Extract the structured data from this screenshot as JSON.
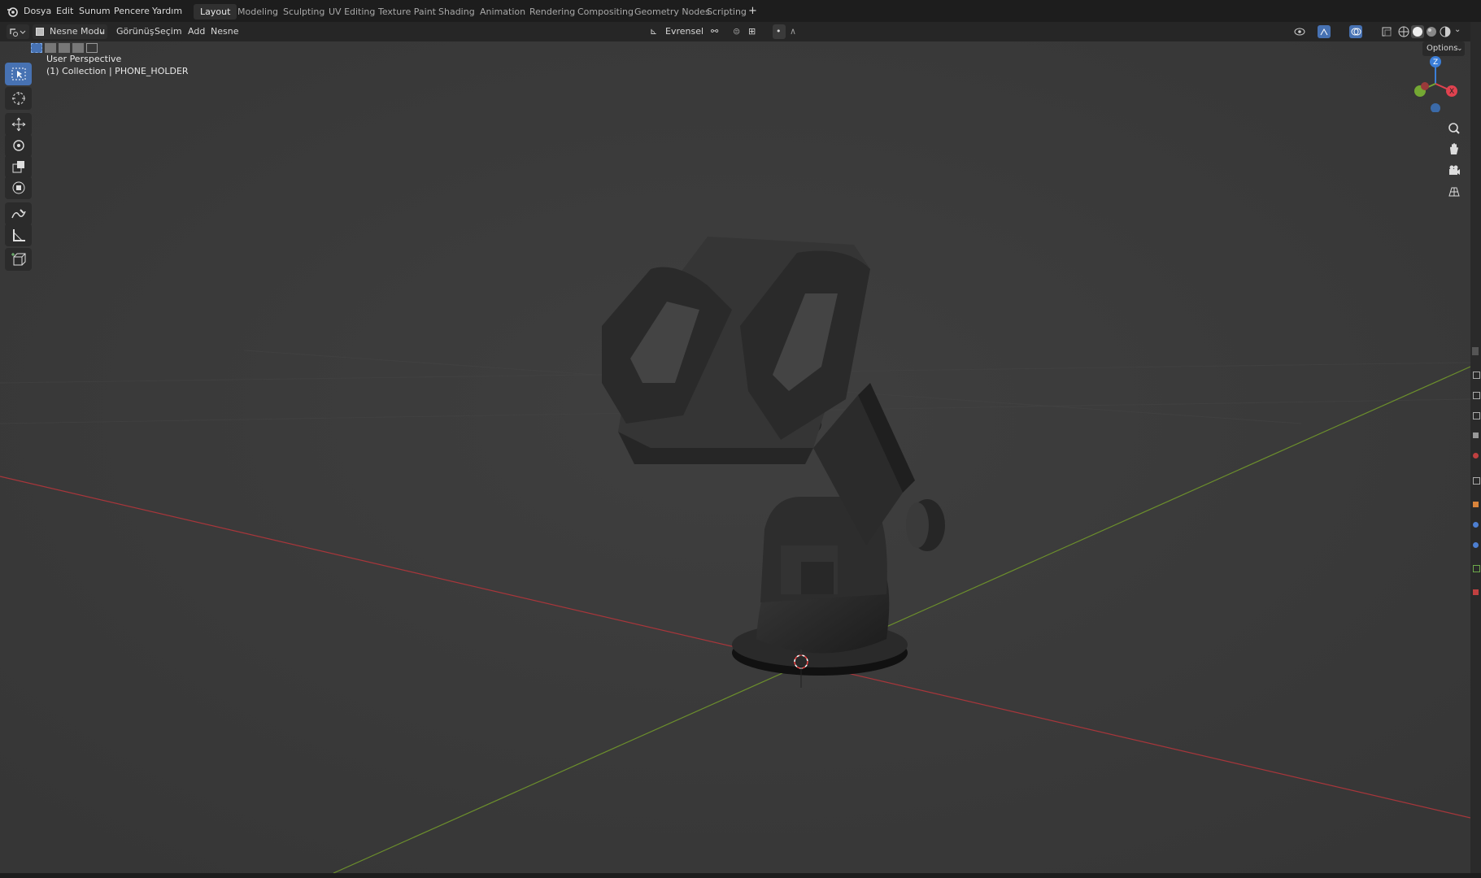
{
  "menu": {
    "app_icon": "blender-logo-icon",
    "items": [
      "Dosya",
      "Edit",
      "Sunum",
      "Pencere",
      "Yardım"
    ]
  },
  "workspaces": [
    "Layout",
    "Modeling",
    "Sculpting",
    "UV Editing",
    "Texture Paint",
    "Shading",
    "Animation",
    "Rendering",
    "Compositing",
    "Geometry Nodes",
    "Scripting"
  ],
  "workspaces_add": "+",
  "header": {
    "mode": "Nesne Modu",
    "menus": [
      "Görünüş",
      "Seçim",
      "Add",
      "Nesne"
    ],
    "orientation": "Evrensel",
    "options": "Options"
  },
  "viewport": {
    "perspective": "User Perspective",
    "collection": "(1) Collection | PHONE_HOLDER"
  },
  "gizmo": {
    "z": "Z",
    "x": "X",
    "x_color": "#e0424f",
    "y_color": "#74a833",
    "z_color": "#3b7ed8"
  },
  "tools": [
    "select-box-icon",
    "cursor-icon",
    "move-icon",
    "rotate-icon",
    "scale-icon",
    "transform-icon",
    "annotate-icon",
    "measure-icon",
    "add-cube-icon"
  ],
  "colors": {
    "x_axis": "#b63d42",
    "y_axis": "#6c8f2c",
    "viewport_bg": "#3b3b3b",
    "accent": "#4772b3"
  }
}
